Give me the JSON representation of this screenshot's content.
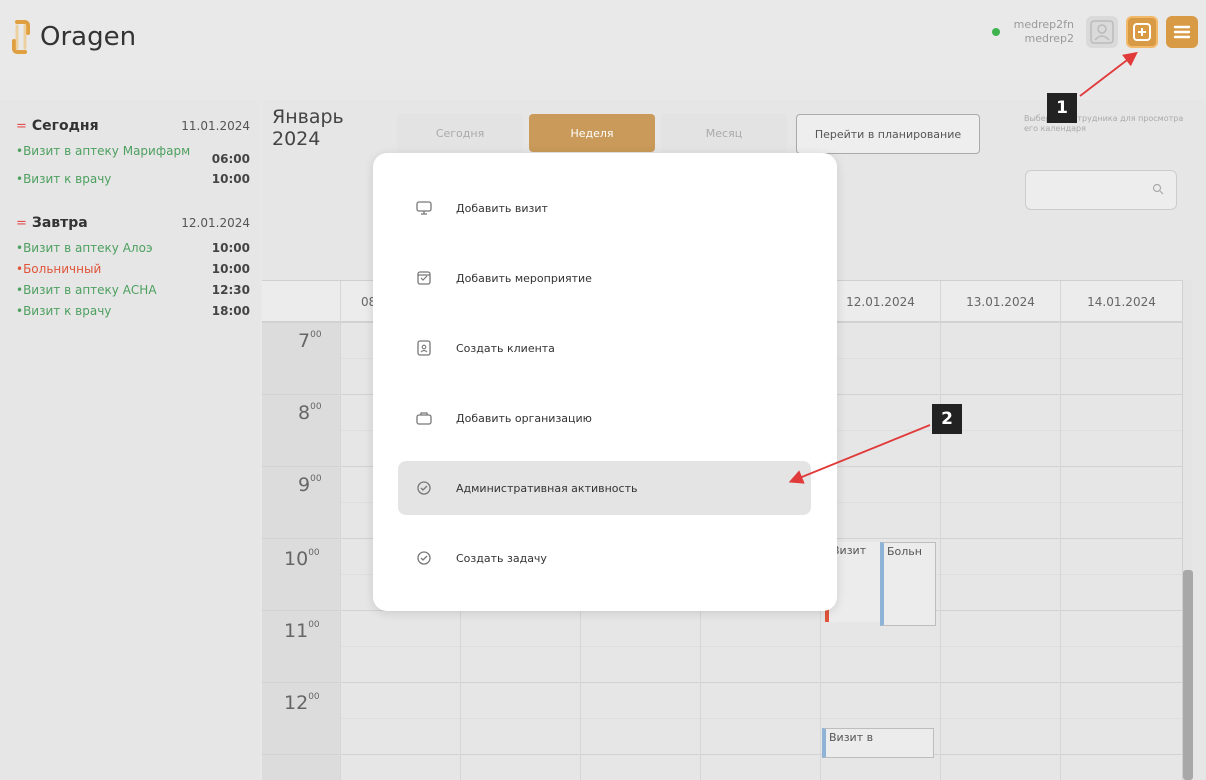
{
  "app": {
    "name": "Oragen"
  },
  "user": {
    "line1": "medrep2fn",
    "line2": "medrep2",
    "status_color": "#3fb34f"
  },
  "header_icons": [
    "user-avatar-icon",
    "plus-square-icon",
    "hamburger-menu-icon"
  ],
  "sidebar": {
    "today": {
      "title": "Сегодня",
      "date": "11.01.2024",
      "events": [
        {
          "name": "•Визит в аптеку Марифарм",
          "time": "06:00"
        },
        {
          "name": "•Визит к врачу",
          "time": "10:00"
        }
      ]
    },
    "tomorrow": {
      "title": "Завтра",
      "date": "12.01.2024",
      "events": [
        {
          "name": "•Визит в аптеку Алоэ",
          "time": "10:00"
        },
        {
          "name": "•Больничный",
          "time": "10:00"
        },
        {
          "name": "•Визит в аптеку АСНА",
          "time": "12:30"
        },
        {
          "name": "•Визит к врачу",
          "time": "18:00"
        }
      ]
    }
  },
  "calendar": {
    "month_title": "Январь 2024",
    "tabs": [
      "Сегодня",
      "Неделя",
      "Месяц"
    ],
    "active_tab": "Неделя",
    "plan_button": "Перейти в планирование",
    "employee_picker_label": "Выберите сотрудника для просмотра его календаря",
    "columns": [
      "08",
      "",
      "",
      "",
      "12.01.2024",
      "13.01.2024",
      "14.01.2024"
    ],
    "hours": [
      "7",
      "8",
      "9",
      "10",
      "11",
      "12"
    ],
    "hour_suffix": "00",
    "events": [
      {
        "label": "Визит",
        "accent": "#e0553a"
      },
      {
        "label": "Больн",
        "accent": "#8fb3d6"
      },
      {
        "label": "Визит в",
        "accent": "#8fb3d6"
      }
    ]
  },
  "popup_menu": {
    "items": [
      {
        "label": "Добавить визит",
        "icon": "monitor-icon"
      },
      {
        "label": "Добавить мероприятие",
        "icon": "calendar-icon"
      },
      {
        "label": "Создать клиента",
        "icon": "document-user-icon"
      },
      {
        "label": "Добавить организацию",
        "icon": "briefcase-icon"
      },
      {
        "label": "Административная активность",
        "icon": "check-circle-icon"
      },
      {
        "label": "Создать задачу",
        "icon": "check-circle-icon"
      }
    ],
    "highlighted_item": "Административная активность"
  },
  "annotations": {
    "callout_1": "1",
    "callout_2": "2",
    "arrow_color": "#e03a3a"
  },
  "colors": {
    "accent": "#d89a44",
    "active_tab": "#c99a5a",
    "green_text": "#4da060",
    "red_text": "#e0553a"
  }
}
